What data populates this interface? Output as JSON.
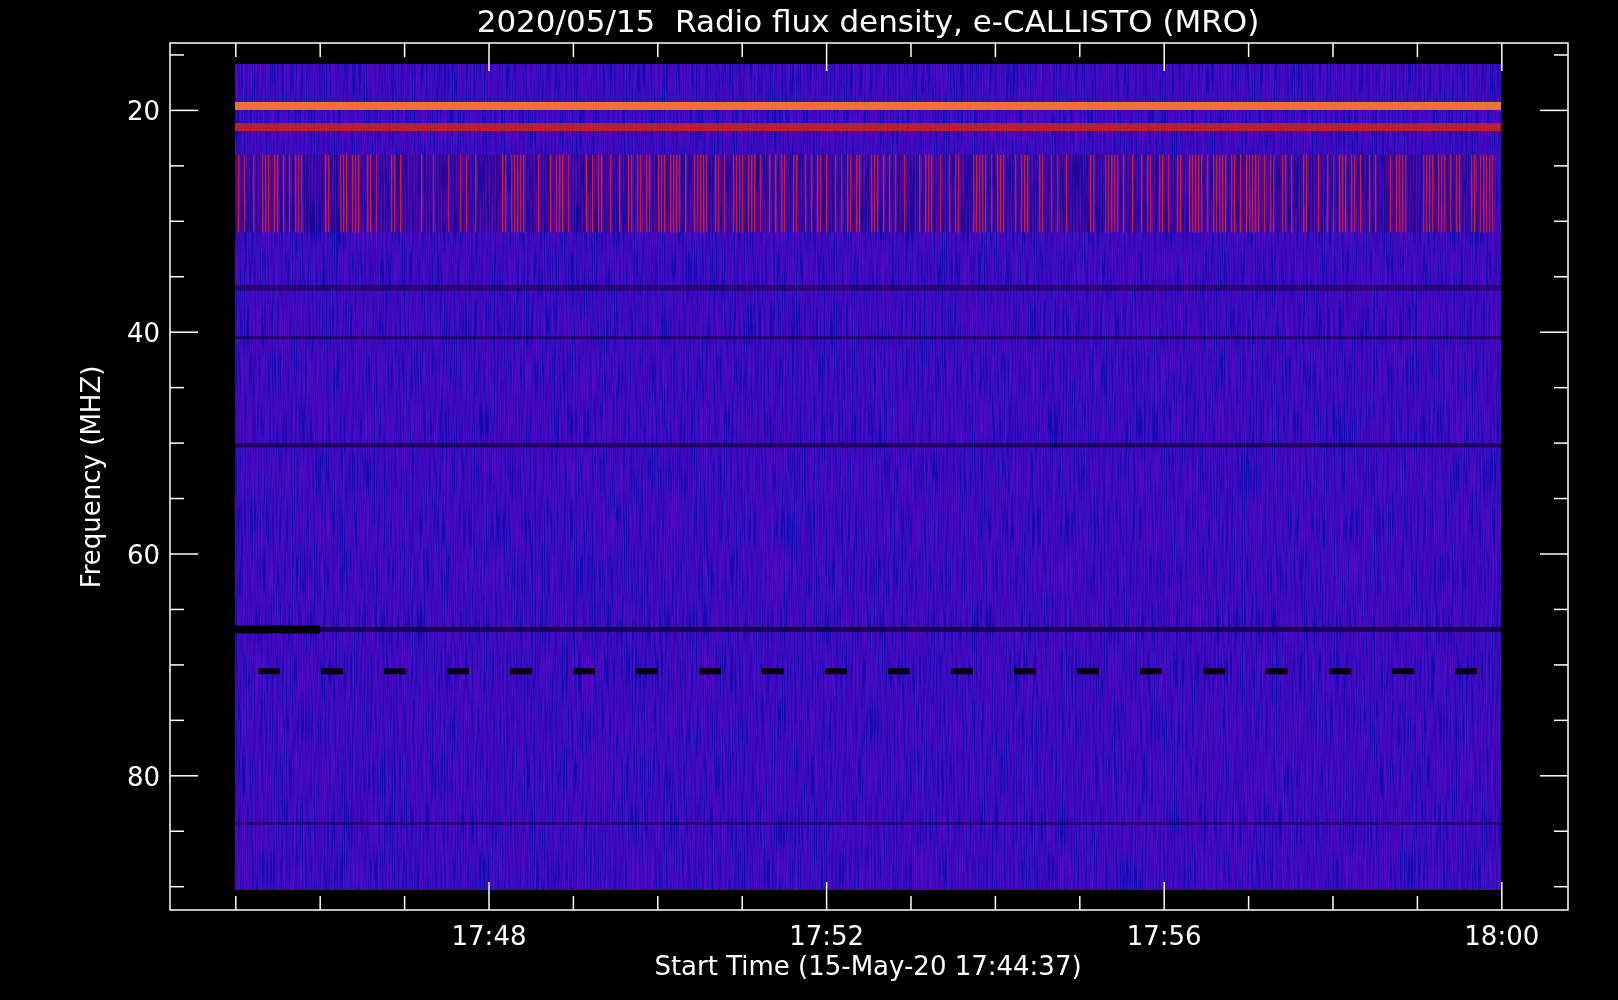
{
  "title": "2020/05/15  Radio flux density, e-CALLISTO (MRO)",
  "plot": {
    "ylabel": "Frequency (MHZ)",
    "xlabel": "Start Time (15-May-20 17:44:37)",
    "yticks": [
      "20",
      "40",
      "60",
      "80"
    ],
    "xticks": [
      "17:48",
      "17:52",
      "17:56",
      "18:00"
    ]
  }
}
